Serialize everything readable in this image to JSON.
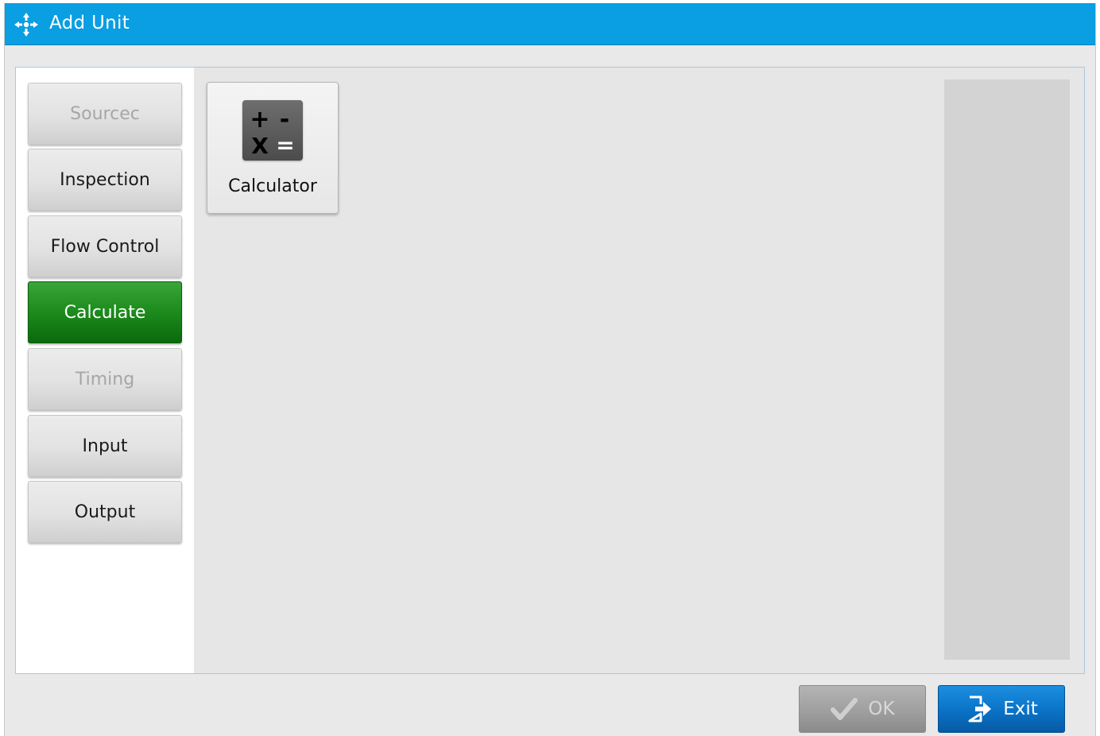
{
  "window": {
    "title": "Add Unit",
    "title_icon": "four-way-arrows-icon",
    "accent_color": "#0a9ee2"
  },
  "sidebar": {
    "items": [
      {
        "label": "Sourcec",
        "state": "disabled"
      },
      {
        "label": "Inspection",
        "state": "enabled"
      },
      {
        "label": "Flow Control",
        "state": "enabled"
      },
      {
        "label": "Calculate",
        "state": "selected"
      },
      {
        "label": "Timing",
        "state": "disabled"
      },
      {
        "label": "Input",
        "state": "enabled"
      },
      {
        "label": "Output",
        "state": "enabled"
      }
    ],
    "selected_color": "#1c8a1c"
  },
  "main": {
    "tools": [
      {
        "label": "Calculator",
        "icon": "calculator-icon",
        "glyphs": {
          "plus": "+",
          "minus": "-",
          "times": "X",
          "equals": "="
        }
      }
    ]
  },
  "footer": {
    "ok_label": "OK",
    "ok_icon": "checkmark-icon",
    "ok_state": "disabled",
    "exit_label": "Exit",
    "exit_icon": "exit-door-icon",
    "exit_color": "#0a72c6"
  }
}
